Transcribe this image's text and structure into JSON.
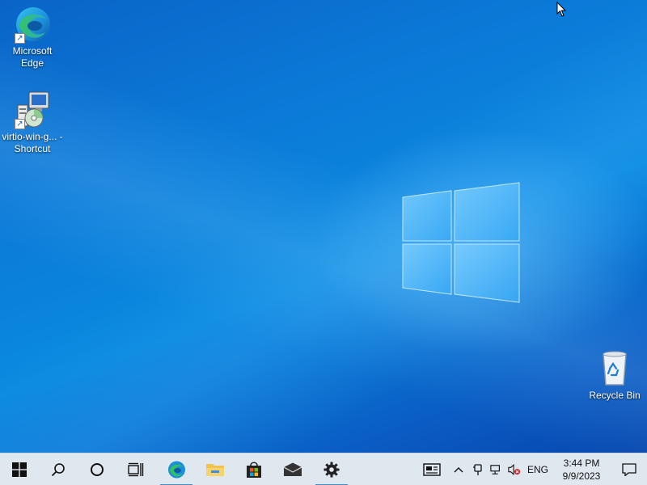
{
  "desktop": {
    "icons": [
      {
        "label": "Microsoft Edge",
        "icon": "edge-icon"
      },
      {
        "label": "virtio-win-g... - Shortcut",
        "icon": "installer-icon"
      },
      {
        "label": "Recycle Bin",
        "icon": "recycle-bin-icon"
      }
    ]
  },
  "taskbar": {
    "buttons": [
      {
        "name": "start-button",
        "icon": "windows-logo-icon"
      },
      {
        "name": "search-button",
        "icon": "search-icon"
      },
      {
        "name": "cortana-button",
        "icon": "circle-icon"
      },
      {
        "name": "task-view-button",
        "icon": "task-view-icon"
      },
      {
        "name": "edge-taskbar-button",
        "icon": "edge-icon"
      },
      {
        "name": "file-explorer-button",
        "icon": "folder-icon"
      },
      {
        "name": "store-button",
        "icon": "store-icon"
      },
      {
        "name": "mail-button",
        "icon": "mail-icon"
      },
      {
        "name": "settings-button",
        "icon": "gear-icon"
      }
    ],
    "tray": {
      "language": "ENG",
      "time": "3:44 PM",
      "date": "9/9/2023"
    }
  },
  "colors": {
    "accent": "#3b8de0",
    "taskbar_bg": "#dfe7ef",
    "wallpaper": "#0a7ad8"
  }
}
